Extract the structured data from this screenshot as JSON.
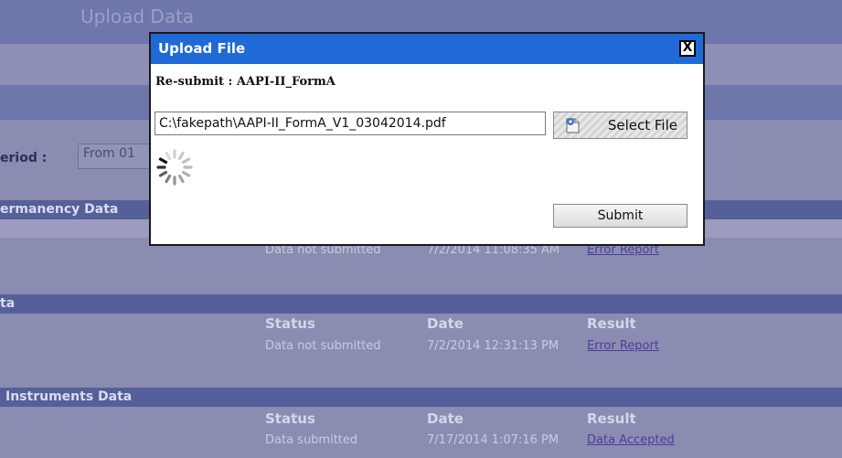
{
  "background": {
    "page_title": "Upload Data",
    "period_label": "eriod :",
    "period_value": "From 01",
    "sections": [
      {
        "title": "ermanency Data",
        "rows": [
          {
            "status": "Data not submitted",
            "date": "7/2/2014 11:08:35 AM",
            "result": "Error Report"
          }
        ]
      },
      {
        "title": "ta",
        "headers": {
          "status": "Status",
          "date": "Date",
          "result": "Result"
        },
        "rows": [
          {
            "status": "Data not submitted",
            "date": "7/2/2014 12:31:13 PM",
            "result": "Error Report"
          }
        ]
      },
      {
        "title": "Instruments Data",
        "headers": {
          "status": "Status",
          "date": "Date",
          "result": "Result"
        },
        "rows": [
          {
            "status": "Data submitted",
            "date": "7/17/2014 1:07:16 PM",
            "result": "Data Accepted"
          }
        ]
      }
    ]
  },
  "modal": {
    "title": "Upload File",
    "close_glyph": "X",
    "resubmit_text": "Re-submit : AAPI-II_FormA",
    "file_path": "C:\\fakepath\\AAPI-II_FormA_V1_03042014.pdf",
    "select_file_label": "Select File",
    "submit_label": "Submit"
  },
  "colors": {
    "header_blue": "#1f6ad6",
    "overlay": "#8b8cb2",
    "section_bar": "#55609a"
  }
}
